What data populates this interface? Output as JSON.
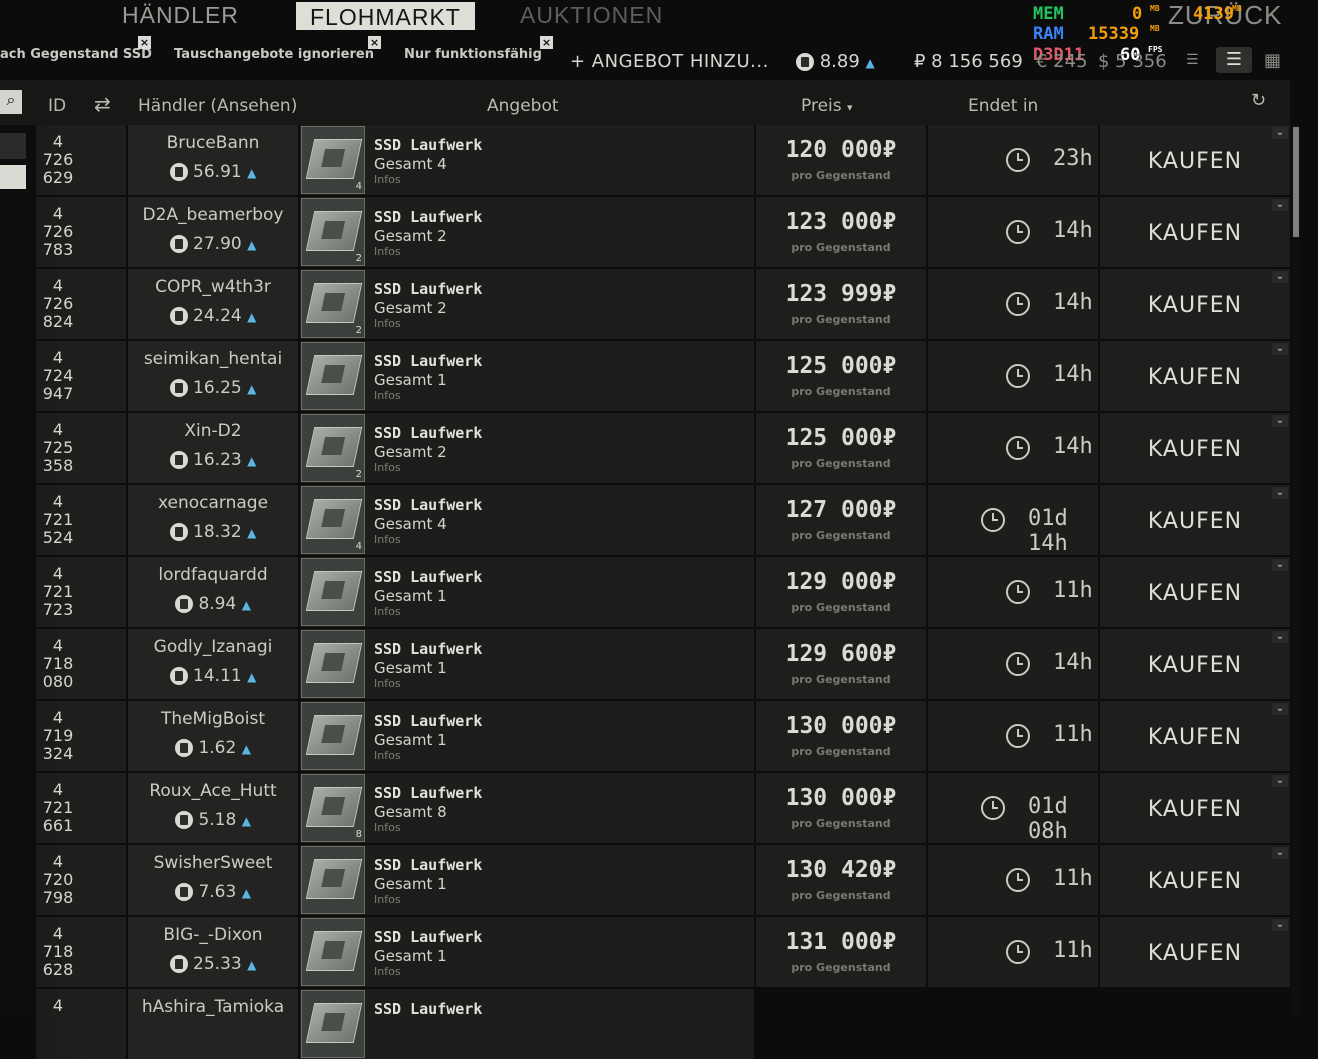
{
  "tabs": [
    {
      "label": "HÄNDLER"
    },
    {
      "label": "FLOHMARKT"
    },
    {
      "label": "AUKTIONEN"
    }
  ],
  "back_label": "ZURÜCK",
  "filters": [
    {
      "label": "ach Gegenstand SSD"
    },
    {
      "label": "Tauschangebote ignorieren"
    },
    {
      "label": "Nur funktionsfähig"
    }
  ],
  "add_offer_label": "+ ANGEBOT HINZU...",
  "currency": {
    "rating": "8.89",
    "roubles": "₽ 8 156 569",
    "euros": "€ 245",
    "dollars": "$ 5 356"
  },
  "overlay": {
    "mem_label": "MEM",
    "mem_val": "0",
    "mem_unit": "MB",
    "ram_label": "RAM",
    "ram_val": "15339",
    "ram_unit": "MB",
    "gpu_val": "4139",
    "gpu_unit": "MB",
    "api": "D3D11",
    "fps": "60",
    "fps_unit": "FPS"
  },
  "columns": {
    "id": "ID",
    "trader": "Händler (Ansehen)",
    "offer": "Angebot",
    "price": "Preis",
    "ends": "Endet in"
  },
  "colors": {
    "accent_blue": "#5ab5e6",
    "mem_green": "#22c55e",
    "ram_orange": "#f59e0b",
    "api_red": "#e05a6a"
  },
  "rows": [
    {
      "id": "4\n726\n629",
      "trader": "BruceBann",
      "rep": "56.91",
      "item": "SSD Laufwerk",
      "total": "Gesamt 4",
      "info": "Infos",
      "qty": "4",
      "price": "120 000",
      "per": "pro Gegenstand",
      "time": "23h",
      "buy": "KAUFEN"
    },
    {
      "id": "4\n726\n783",
      "trader": "D2A_beamerboy",
      "rep": "27.90",
      "item": "SSD Laufwerk",
      "total": "Gesamt 2",
      "info": "Infos",
      "qty": "2",
      "price": "123 000",
      "per": "pro Gegenstand",
      "time": "14h",
      "buy": "KAUFEN"
    },
    {
      "id": "4\n726\n824",
      "trader": "COPR_w4th3r",
      "rep": "24.24",
      "item": "SSD Laufwerk",
      "total": "Gesamt 2",
      "info": "Infos",
      "qty": "2",
      "price": "123 999",
      "per": "pro Gegenstand",
      "time": "14h",
      "buy": "KAUFEN"
    },
    {
      "id": "4\n724\n947",
      "trader": "seimikan_hentai",
      "rep": "16.25",
      "item": "SSD Laufwerk",
      "total": "Gesamt 1",
      "info": "Infos",
      "qty": "",
      "price": "125 000",
      "per": "pro Gegenstand",
      "time": "14h",
      "buy": "KAUFEN"
    },
    {
      "id": "4\n725\n358",
      "trader": "Xin-D2",
      "rep": "16.23",
      "item": "SSD Laufwerk",
      "total": "Gesamt 2",
      "info": "Infos",
      "qty": "2",
      "price": "125 000",
      "per": "pro Gegenstand",
      "time": "14h",
      "buy": "KAUFEN"
    },
    {
      "id": "4\n721\n524",
      "trader": "xenocarnage",
      "rep": "18.32",
      "item": "SSD Laufwerk",
      "total": "Gesamt 4",
      "info": "Infos",
      "qty": "4",
      "price": "127 000",
      "per": "pro Gegenstand",
      "time": "01d 14h",
      "buy": "KAUFEN"
    },
    {
      "id": "4\n721\n723",
      "trader": "lordfaquardd",
      "rep": "8.94",
      "item": "SSD Laufwerk",
      "total": "Gesamt 1",
      "info": "Infos",
      "qty": "",
      "price": "129 000",
      "per": "pro Gegenstand",
      "time": "11h",
      "buy": "KAUFEN"
    },
    {
      "id": "4\n718\n080",
      "trader": "Godly_Izanagi",
      "rep": "14.11",
      "item": "SSD Laufwerk",
      "total": "Gesamt 1",
      "info": "Infos",
      "qty": "",
      "price": "129 600",
      "per": "pro Gegenstand",
      "time": "14h",
      "buy": "KAUFEN"
    },
    {
      "id": "4\n719\n324",
      "trader": "TheMigBoist",
      "rep": "1.62",
      "item": "SSD Laufwerk",
      "total": "Gesamt 1",
      "info": "Infos",
      "qty": "",
      "price": "130 000",
      "per": "pro Gegenstand",
      "time": "11h",
      "buy": "KAUFEN"
    },
    {
      "id": "4\n721\n661",
      "trader": "Roux_Ace_Hutt",
      "rep": "5.18",
      "item": "SSD Laufwerk",
      "total": "Gesamt 8",
      "info": "Infos",
      "qty": "8",
      "price": "130 000",
      "per": "pro Gegenstand",
      "time": "01d 08h",
      "buy": "KAUFEN"
    },
    {
      "id": "4\n720\n798",
      "trader": "SwisherSweet",
      "rep": "7.63",
      "item": "SSD Laufwerk",
      "total": "Gesamt 1",
      "info": "Infos",
      "qty": "",
      "price": "130 420",
      "per": "pro Gegenstand",
      "time": "11h",
      "buy": "KAUFEN"
    },
    {
      "id": "4\n718\n628",
      "trader": "BIG-_-Dixon",
      "rep": "25.33",
      "item": "SSD Laufwerk",
      "total": "Gesamt 1",
      "info": "Infos",
      "qty": "",
      "price": "131 000",
      "per": "pro Gegenstand",
      "time": "11h",
      "buy": "KAUFEN"
    },
    {
      "id": "4",
      "trader": "hAshira_Tamioka",
      "rep": "",
      "item": "SSD Laufwerk",
      "total": "",
      "info": "",
      "qty": "",
      "price": "",
      "per": "",
      "time": "",
      "buy": ""
    }
  ]
}
